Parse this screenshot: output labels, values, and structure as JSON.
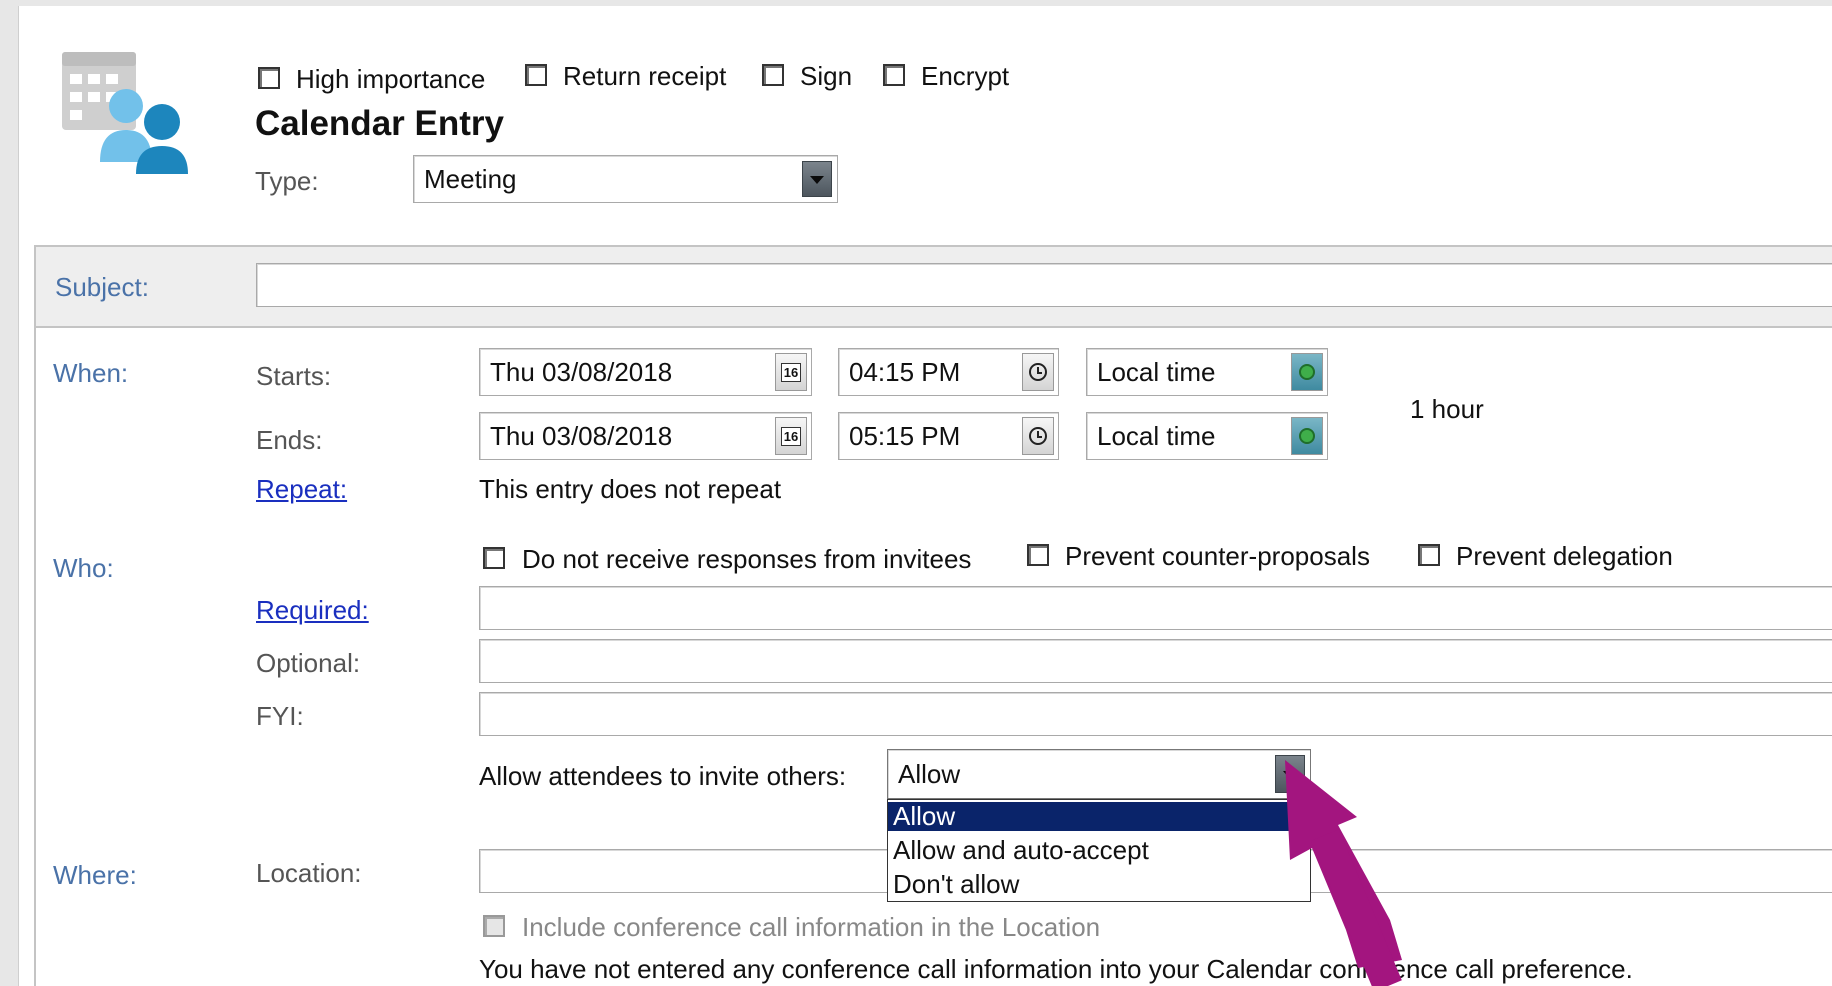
{
  "options": {
    "high_importance": "High importance",
    "return_receipt": "Return receipt",
    "sign": "Sign",
    "encrypt": "Encrypt"
  },
  "entry_title": "Calendar Entry",
  "type": {
    "label": "Type:",
    "value": "Meeting"
  },
  "subject": {
    "label": "Subject:",
    "value": ""
  },
  "when": {
    "section": "When:",
    "starts_label": "Starts:",
    "ends_label": "Ends:",
    "start_date": "Thu 03/08/2018",
    "start_time": "04:15 PM",
    "start_zone": "Local time",
    "end_date": "Thu 03/08/2018",
    "end_time": "05:15 PM",
    "end_zone": "Local time",
    "duration": "1 hour",
    "calendar_icon_text": "16",
    "repeat_label": "Repeat:",
    "repeat_text": "This entry does not repeat"
  },
  "who": {
    "section": "Who:",
    "no_responses": "Do not receive responses from invitees",
    "prevent_counter": "Prevent counter-proposals",
    "prevent_delegation": "Prevent delegation",
    "required_label": "Required:",
    "optional_label": "Optional:",
    "fyi_label": "FYI:",
    "invite_label": "Allow attendees to invite others:",
    "invite_value": "Allow",
    "invite_options": [
      "Allow",
      "Allow and auto-accept",
      "Don't allow"
    ]
  },
  "where": {
    "section": "Where:",
    "location_label": "Location:",
    "conference_checkbox": "Include conference call information in the Location",
    "conference_note": "You have not entered any conference call information into your Calendar conference call preference."
  },
  "colors": {
    "section_label": "#4a72a8",
    "link": "#1a2fbf",
    "selection": "#0a246a",
    "arrow": "#a3157f"
  }
}
